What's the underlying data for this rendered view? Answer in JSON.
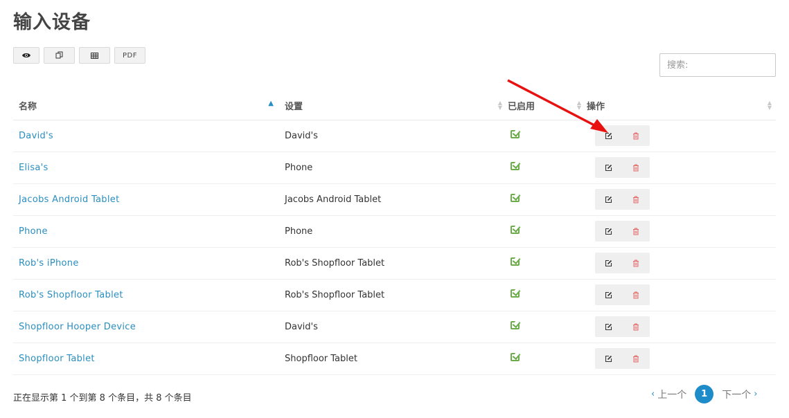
{
  "page": {
    "title": "输入设备"
  },
  "toolbar": {
    "pdf_label": "PDF"
  },
  "search": {
    "placeholder": "搜索:"
  },
  "table": {
    "headers": {
      "name": "名称",
      "settings": "设置",
      "enabled": "已启用",
      "actions": "操作"
    },
    "rows": [
      {
        "name": "David's",
        "setting": "David's",
        "enabled": true
      },
      {
        "name": "Elisa's",
        "setting": "Phone",
        "enabled": true
      },
      {
        "name": "Jacobs Android Tablet",
        "setting": "Jacobs Android Tablet",
        "enabled": true
      },
      {
        "name": "Phone",
        "setting": "Phone",
        "enabled": true
      },
      {
        "name": "Rob's iPhone",
        "setting": "Rob's Shopfloor Tablet",
        "enabled": true
      },
      {
        "name": "Rob's Shopfloor Tablet",
        "setting": "Rob's Shopfloor Tablet",
        "enabled": true
      },
      {
        "name": "Shopfloor Hooper Device",
        "setting": "David's",
        "enabled": true
      },
      {
        "name": "Shopfloor Tablet",
        "setting": "Shopfloor Tablet",
        "enabled": true
      }
    ]
  },
  "footer": {
    "info": "正在显示第 1 个到第 8 个条目，共 8 个条目"
  },
  "pagination": {
    "prev": "上一个",
    "current": "1",
    "next": "下一个"
  },
  "colors": {
    "link": "#2a8ec0",
    "check": "#6cab4a",
    "delete": "#e06666",
    "annotation_arrow": "#e8110f"
  }
}
